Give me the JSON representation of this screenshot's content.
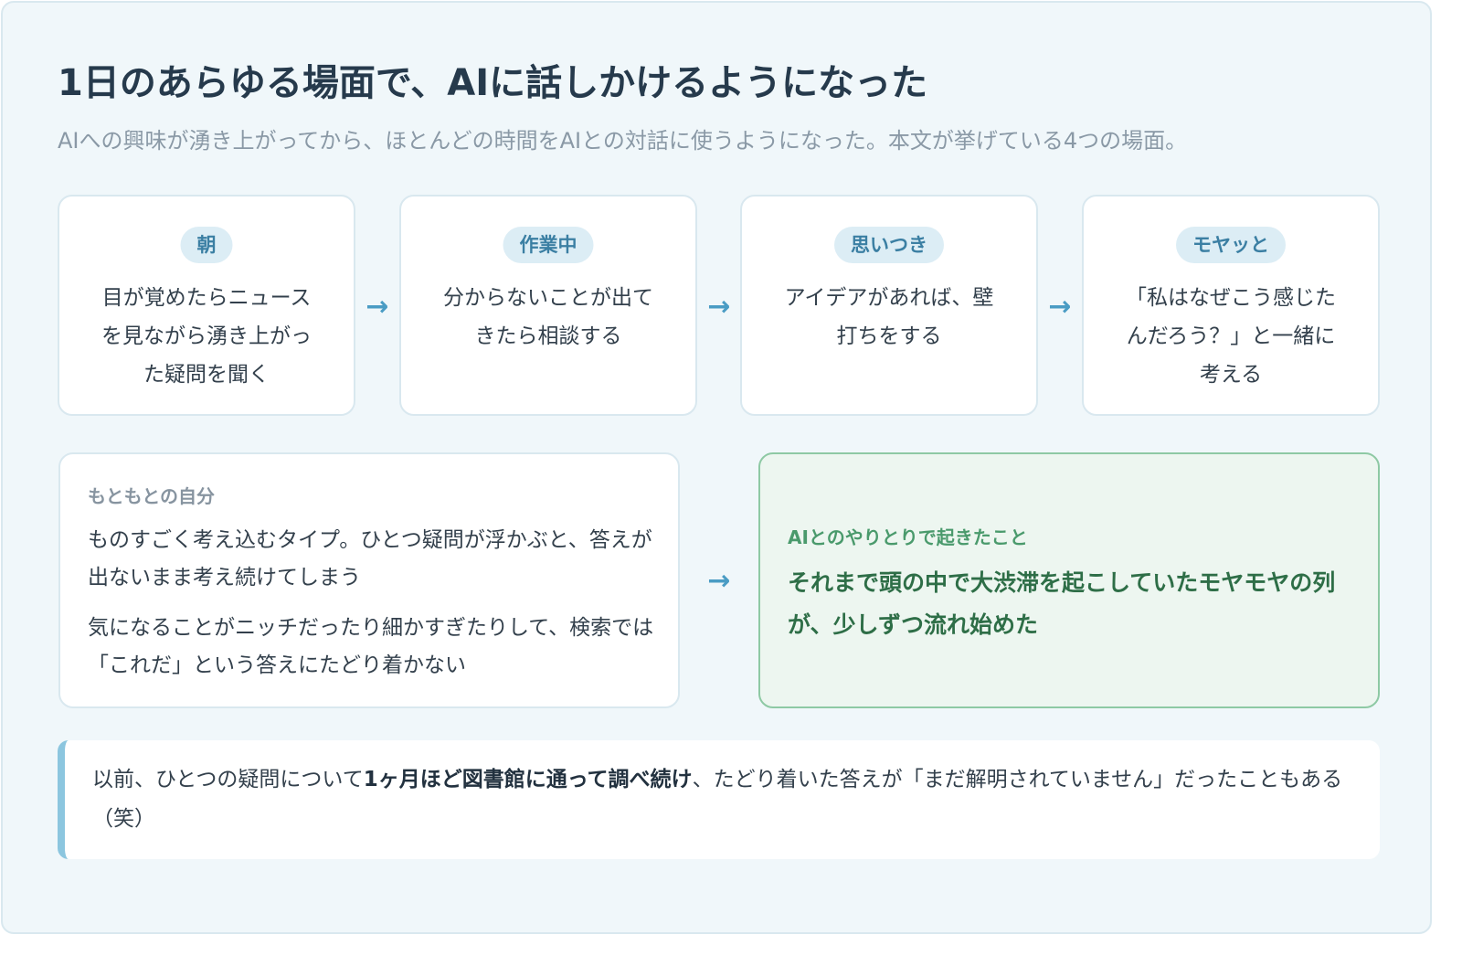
{
  "title": "1日のあらゆる場面で、AIに話しかけるようになった",
  "subtitle": "AIへの興味が湧き上がってから、ほとんどの時間をAIとの対話に使うようになった。本文が挙げている4つの場面。",
  "steps": [
    {
      "tag": "朝",
      "text": "目が覚めたらニュースを見ながら湧き上がった疑問を聞く"
    },
    {
      "tag": "作業中",
      "text": "分からないことが出てきたら相談する"
    },
    {
      "tag": "思いつき",
      "text": "アイデアがあれば、壁打ちをする"
    },
    {
      "tag": "モヤッと",
      "text": "「私はなぜこう感じたんだろう？」と一緒に考える"
    }
  ],
  "before": {
    "heading": "もともとの自分",
    "p1": "ものすごく考え込むタイプ。ひとつ疑問が浮かぶと、答えが出ないまま考え続けてしまう",
    "p2": "気になることがニッチだったり細かすぎたりして、検索では「これだ」という答えにたどり着かない"
  },
  "after": {
    "heading": "AIとのやりとりで起きたこと",
    "text": "それまで頭の中で大渋滞を起こしていたモヤモヤの列が、少しずつ流れ始めた"
  },
  "note": {
    "pre": "以前、ひとつの疑問について",
    "bold": "1ヶ月ほど図書館に通って調べ続け",
    "post": "、たどり着いた答えが「まだ解明されていません」だったこともある（笑）"
  },
  "arrow_glyph": "→",
  "colors": {
    "accent": "#4a9cc4",
    "tag_bg": "#dcedf5",
    "green": "#2e6e47",
    "green_bg": "#edf6f0",
    "note_bar": "#8cc6df"
  }
}
